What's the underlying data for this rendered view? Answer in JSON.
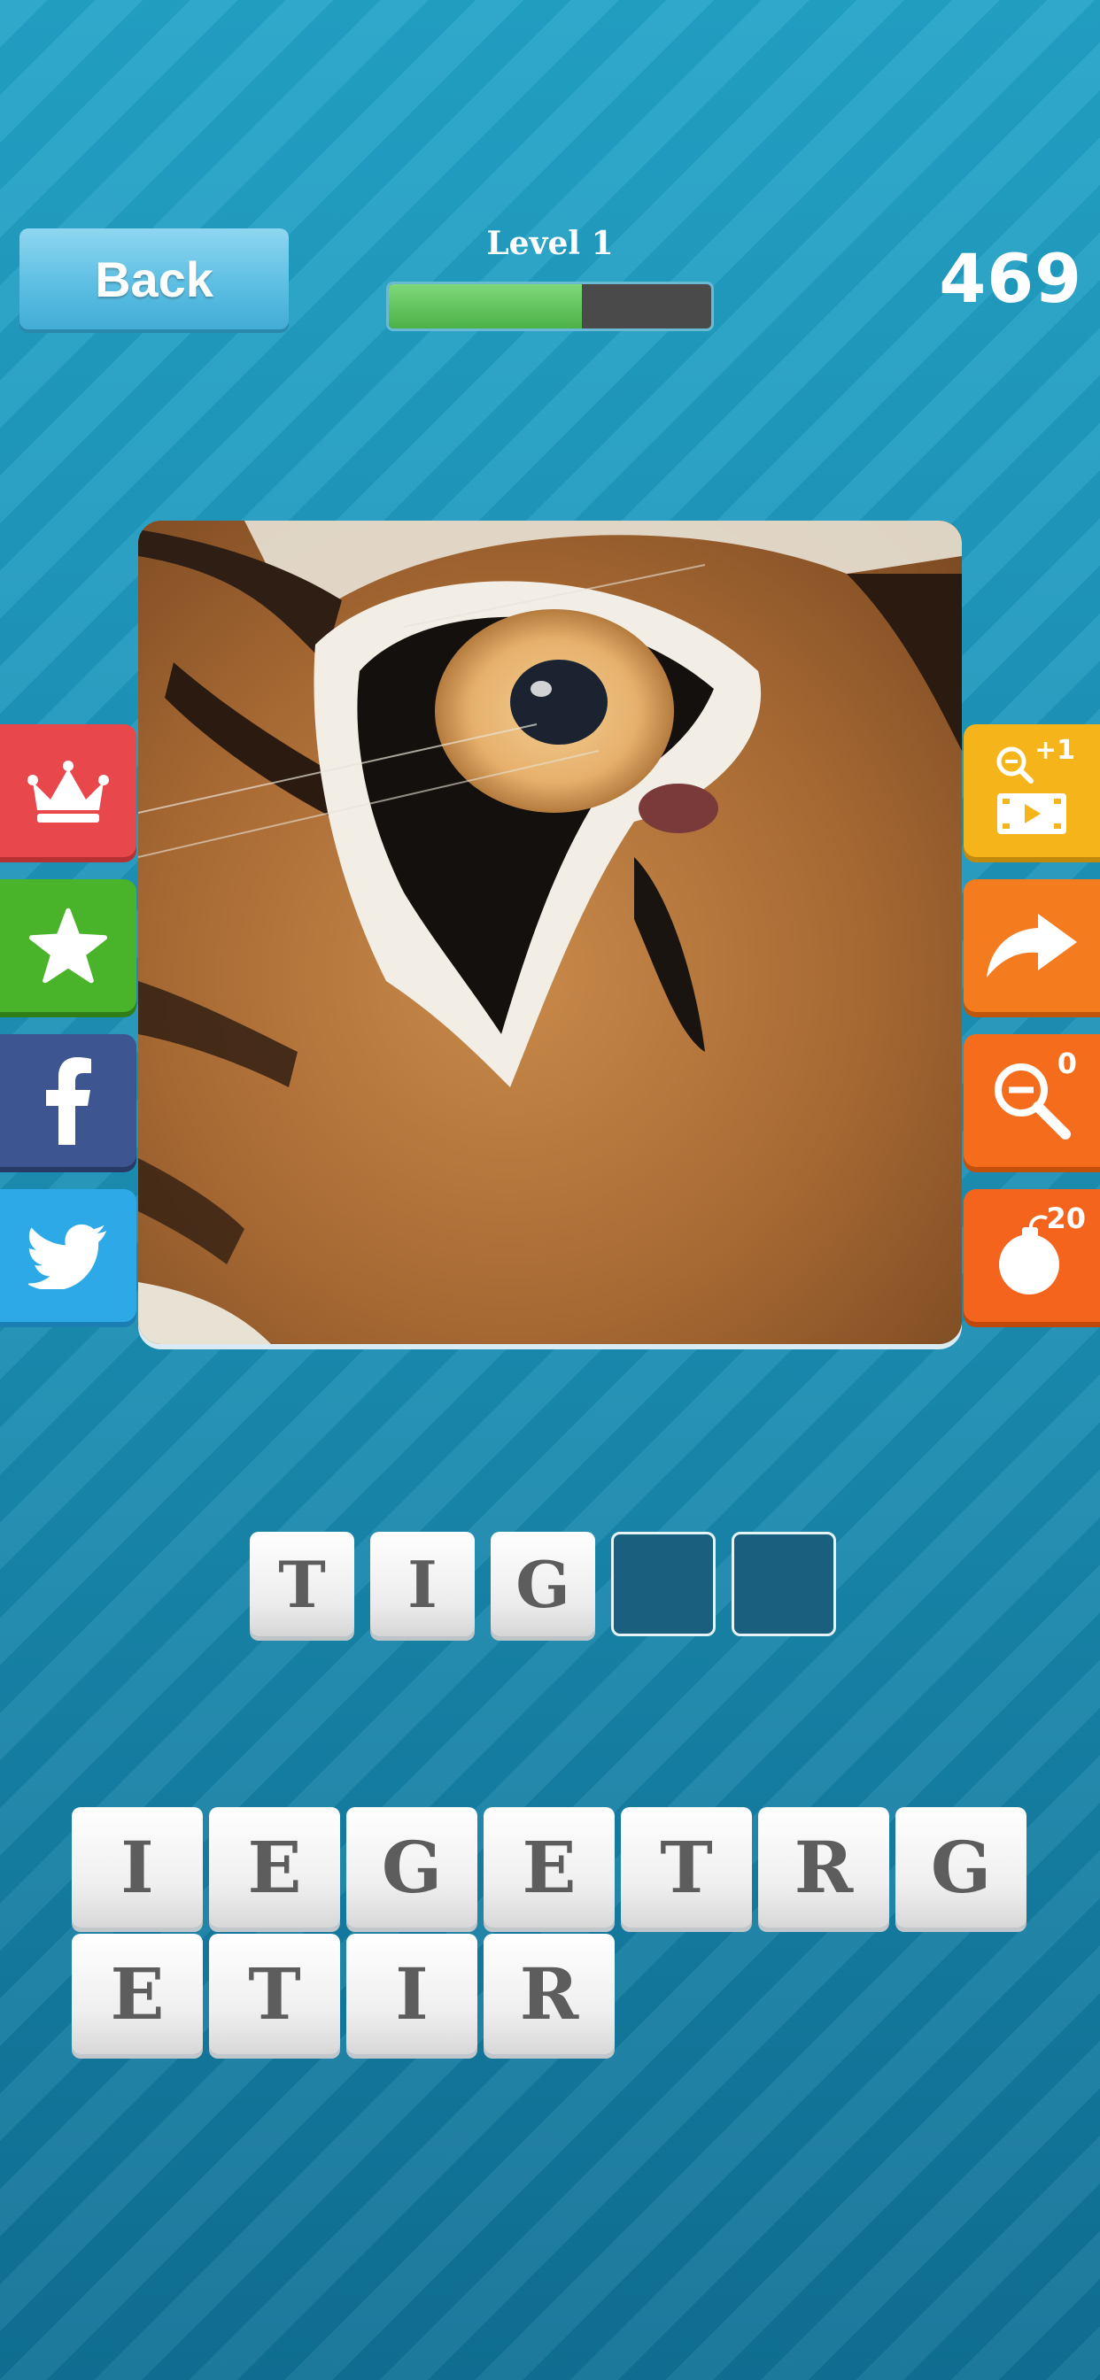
{
  "header": {
    "back_label": "Back",
    "level_label": "Level 1",
    "progress_fraction": 0.6,
    "coins": "469"
  },
  "left_buttons": [
    {
      "icon": "crown-icon",
      "color": "#e8484c"
    },
    {
      "icon": "star-icon",
      "color": "#49b32a"
    },
    {
      "icon": "facebook-icon",
      "color": "#3d5691"
    },
    {
      "icon": "twitter-icon",
      "color": "#2ca9e6"
    }
  ],
  "right_buttons": [
    {
      "icon": "zoom-video-icon",
      "badge": "+1",
      "color": "#f4b41a"
    },
    {
      "icon": "share-arrow-icon",
      "badge": "",
      "color": "#f57b1f"
    },
    {
      "icon": "zoom-out-icon",
      "badge": "0",
      "color": "#f56d1c"
    },
    {
      "icon": "bomb-icon",
      "badge": "20",
      "color": "#f5641c"
    }
  ],
  "answer": {
    "slots": [
      "T",
      "I",
      "G",
      "",
      ""
    ]
  },
  "letter_bank": {
    "row1": [
      "I",
      "E",
      "G",
      "E",
      "T",
      "R",
      "G"
    ],
    "row2": [
      "E",
      "T",
      "I",
      "R"
    ]
  }
}
